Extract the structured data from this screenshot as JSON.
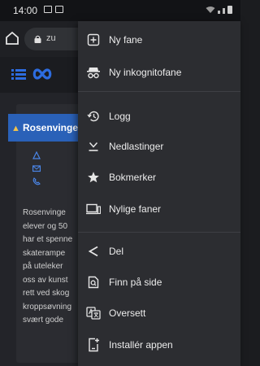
{
  "status_bar": {
    "time": "14:00"
  },
  "toolbar": {
    "url_text": "zu"
  },
  "site": {
    "card_title": "Rosenvinge",
    "paragraph_lines": [
      "Rosenvinge",
      "elever og 50",
      "har et spenne",
      "skaterampe",
      "på uteleker",
      "oss av kunst",
      "rett ved skog",
      "kroppsøvning",
      "svært gode"
    ]
  },
  "menu": {
    "items": [
      {
        "label": "Ny fane",
        "icon": "new-tab-icon"
      },
      {
        "label": "Ny inkognitofane",
        "icon": "incognito-icon"
      },
      {
        "label": "Logg",
        "icon": "history-icon"
      },
      {
        "label": "Nedlastinger",
        "icon": "download-icon"
      },
      {
        "label": "Bokmerker",
        "icon": "star-icon"
      },
      {
        "label": "Nylige faner",
        "icon": "recent-tabs-icon"
      },
      {
        "label": "Del",
        "icon": "share-icon"
      },
      {
        "label": "Finn på side",
        "icon": "find-in-page-icon"
      },
      {
        "label": "Oversett",
        "icon": "translate-icon"
      },
      {
        "label": "Installér appen",
        "icon": "install-app-icon"
      }
    ]
  },
  "colors": {
    "menu_bg": "#2c2d31",
    "card_header": "#2a61b8",
    "logo_blue": "#2d6cdf"
  }
}
